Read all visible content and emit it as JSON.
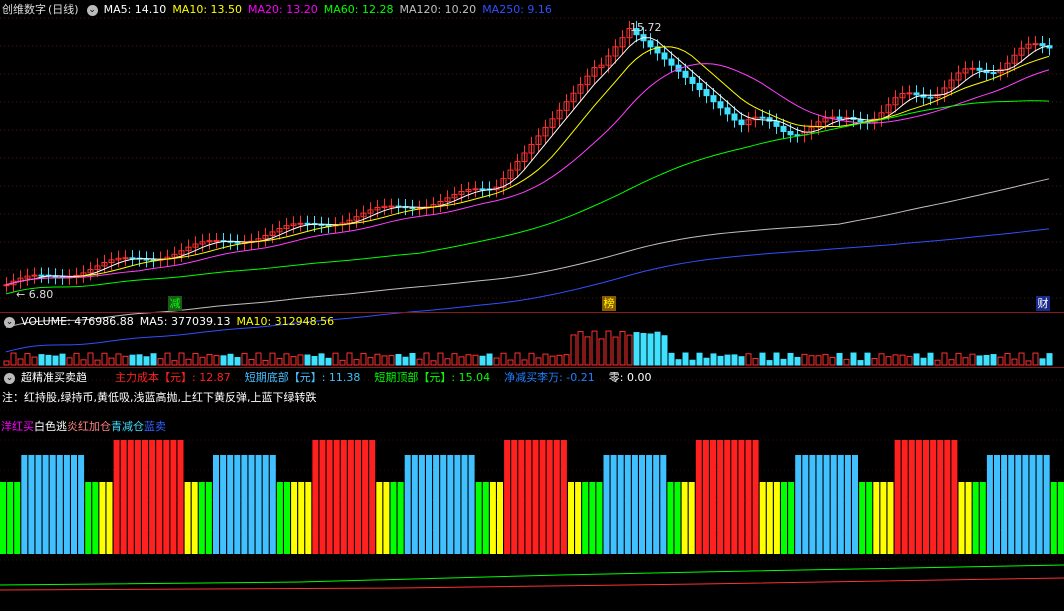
{
  "main_panel": {
    "title": "创维数字",
    "period": "(日线)",
    "ma": [
      {
        "label": "MA5: 14.10",
        "color": "#ffffff"
      },
      {
        "label": "MA10: 13.50",
        "color": "#ffff00"
      },
      {
        "label": "MA20: 13.20",
        "color": "#ff00ff"
      },
      {
        "label": "MA60: 12.28",
        "color": "#00ff00"
      },
      {
        "label": "MA120: 10.20",
        "color": "#c0c0c0"
      },
      {
        "label": "MA250: 9.16",
        "color": "#3050ff"
      }
    ],
    "high_label": "15.72",
    "low_label": "6.80",
    "markers": [
      {
        "text": "减",
        "color": "#00ff00",
        "bg": "#1a5a1a"
      },
      {
        "text": "榜",
        "color": "#ffff00",
        "bg": "#8a5a00"
      },
      {
        "text": "财",
        "color": "#ffffff",
        "bg": "#1a2a8a"
      }
    ]
  },
  "volume_panel": {
    "label": "VOLUME: 476986.88",
    "ma5": "MA5: 377039.13",
    "ma10": "MA10: 312948.56"
  },
  "indicator_panel": {
    "name": "超精准买卖趋",
    "items": [
      {
        "label": "主力成本【元】: 12.87",
        "color": "#ff2020"
      },
      {
        "label": "短期底部【元】: 11.38",
        "color": "#40c0ff"
      },
      {
        "label": "短期顶部【元】: 15.04",
        "color": "#00ff00"
      },
      {
        "label": "净减买李万: -0.21",
        "color": "#2080ff"
      },
      {
        "label": "零: 0.00",
        "color": "#ffffff"
      }
    ],
    "note": "注：红持股,绿持币,黄低吸,浅蓝高抛,上红下黄反弹,上蓝下绿转跌",
    "legend": [
      {
        "text": "洋红买",
        "color": "#ff00ff"
      },
      {
        "text": "白色逃",
        "color": "#ffffff"
      },
      {
        "text": "炎红加仓",
        "color": "#ff8080"
      },
      {
        "text": "青减仓",
        "color": "#40e0ff"
      },
      {
        "text": "蓝卖",
        "color": "#3060ff"
      }
    ]
  }
}
